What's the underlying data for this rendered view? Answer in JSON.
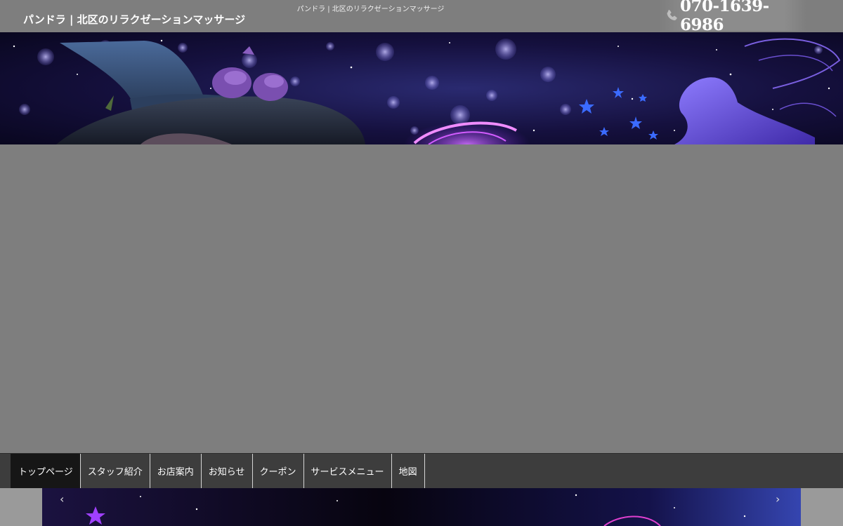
{
  "header": {
    "tagline": "パンドラ | 北区のリラクゼーションマッサージ",
    "site_title": "パンドラ | 北区のリラクゼーションマッサージ",
    "phone": "070-1639-6986",
    "phone_icon": "phone-icon"
  },
  "nav": {
    "items": [
      {
        "label": "トップページ",
        "active": true
      },
      {
        "label": "スタッフ紹介"
      },
      {
        "label": "お店案内"
      },
      {
        "label": "お知らせ"
      },
      {
        "label": "クーポン"
      },
      {
        "label": "サービスメニュー"
      },
      {
        "label": "地図"
      }
    ]
  },
  "slider": {
    "prev": "‹",
    "next": "›"
  },
  "colors": {
    "page_bg": "#7e7e7e",
    "nav_bg": "#3d3d3d",
    "nav_active": "#161616",
    "banner_night": "#10082e",
    "accent_purple": "#a040ff"
  }
}
